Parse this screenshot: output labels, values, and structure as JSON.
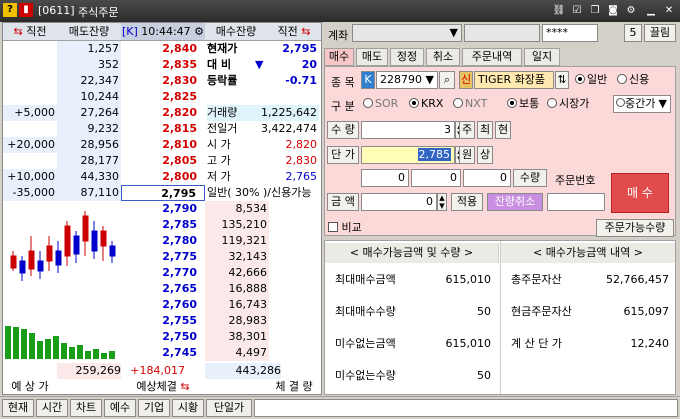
{
  "window": {
    "code": "[0611]",
    "title": "주식주문",
    "help_icon": "question-icon",
    "lock_icon": "lock-icon"
  },
  "book": {
    "headers": {
      "prev_left": "⇆",
      "prev_label": "직전",
      "ask_qty": "매도잔량",
      "time_badge": "[K]",
      "time": "10:44:47",
      "bid_qty": "매수잔량",
      "prev_right": "직전"
    },
    "asks": [
      {
        "chg": "",
        "qty": "1,257",
        "price": "2,840"
      },
      {
        "chg": "",
        "qty": "352",
        "price": "2,835"
      },
      {
        "chg": "",
        "qty": "22,347",
        "price": "2,830"
      },
      {
        "chg": "",
        "qty": "10,244",
        "price": "2,825"
      },
      {
        "chg": "+5,000",
        "qty": "27,264",
        "price": "2,820"
      },
      {
        "chg": "",
        "qty": "9,232",
        "price": "2,815"
      },
      {
        "chg": "+20,000",
        "qty": "28,956",
        "price": "2,810"
      },
      {
        "chg": "",
        "qty": "28,177",
        "price": "2,805"
      },
      {
        "chg": "+10,000",
        "qty": "44,330",
        "price": "2,800"
      },
      {
        "chg": "-35,000",
        "qty": "87,110",
        "price": "2,795"
      }
    ],
    "bids": [
      {
        "price": "2,790",
        "qty": "8,534"
      },
      {
        "price": "2,785",
        "qty": "135,210"
      },
      {
        "price": "2,780",
        "qty": "119,321"
      },
      {
        "price": "2,775",
        "qty": "32,143"
      },
      {
        "price": "2,770",
        "qty": "42,666"
      },
      {
        "price": "2,765",
        "qty": "16,888"
      },
      {
        "price": "2,760",
        "qty": "16,743"
      },
      {
        "price": "2,755",
        "qty": "28,983"
      },
      {
        "price": "2,750",
        "qty": "38,301"
      },
      {
        "price": "2,745",
        "qty": "4,497"
      }
    ],
    "info": [
      {
        "label": "현재가",
        "value": "2,795",
        "color": "blue"
      },
      {
        "label": "대 비",
        "arrow": "▼",
        "value": "20",
        "color": "blue"
      },
      {
        "label": "등락률",
        "value": "-0.71",
        "color": "blue"
      },
      {
        "label": "",
        "value": ""
      },
      {
        "label": "거래량",
        "value": "1,225,642",
        "color": "black"
      },
      {
        "label": "전일거",
        "value": "3,422,474",
        "color": "black"
      },
      {
        "label": "시 가",
        "value": "2,820",
        "color": "red"
      },
      {
        "label": "고 가",
        "value": "2,830",
        "color": "red"
      },
      {
        "label": "저 가",
        "value": "2,765",
        "color": "blue"
      },
      {
        "label": "일반( 30% )/신용가능",
        "value": "",
        "color": "black"
      }
    ],
    "totals": {
      "ask_total": "259,269",
      "diff": "+184,017",
      "bid_total": "443,286"
    },
    "footer": {
      "expected_price": "예 상 가",
      "expected_trade": "예상체결",
      "trade_qty": "체 결 량"
    }
  },
  "right": {
    "account_label": "계좌",
    "password": "****",
    "account_num": "5",
    "close_label": "끌림",
    "tabs": [
      "매수",
      "매도",
      "정정",
      "취소",
      "주문내역",
      "일지"
    ],
    "stock_label": "종 목",
    "stock_badge": "K",
    "stock_code": "228790",
    "credit_badge": "신",
    "stock_name": "TIGER 화장품",
    "type_general": "일반",
    "type_credit": "신용",
    "class_label": "구 분",
    "class_sor": "SOR",
    "class_krx": "KRX",
    "class_nxt": "NXT",
    "order_normal": "보통",
    "order_market": "시장가",
    "order_middle": "중간가",
    "qty_label": "수 량",
    "qty_value": "3",
    "qty_btn1": "주",
    "qty_btn2": "최",
    "qty_btn3": "현",
    "price_label": "단 가",
    "price_value": "2,785",
    "price_btn1": "원",
    "price_btn2": "상",
    "sub_zero1": "0",
    "sub_zero2": "0",
    "sub_zero3": "0",
    "sub_qty": "수량",
    "order_no_label": "주문번호",
    "amount_label": "금 액",
    "amount_value": "0",
    "apply_label": "적용",
    "cancel_rest": "잔량취소",
    "buy_button": "매 수",
    "compare_label": "비교",
    "avail_qty_btn": "주문가능수량",
    "summary": {
      "left_title": "< 매수가능금액 및 수량 >",
      "right_title": "< 매수가능금액 내역 >",
      "rows": [
        {
          "l_label": "최대매수금액",
          "l_value": "615,010",
          "r_label": "총주문자산",
          "r_value": "52,766,457"
        },
        {
          "l_label": "최대매수수량",
          "l_value": "50",
          "r_label": "현금주문자산",
          "r_value": "615,097"
        },
        {
          "l_label": "미수없는금액",
          "l_value": "615,010",
          "r_label": "계 산 단 가",
          "r_value": "12,240"
        },
        {
          "l_label": "미수없는수량",
          "l_value": "50",
          "r_label": "",
          "r_value": ""
        }
      ]
    }
  },
  "bottom_tabs": [
    "현재",
    "시간",
    "차트",
    "예수",
    "기업",
    "시황",
    "단일가"
  ]
}
